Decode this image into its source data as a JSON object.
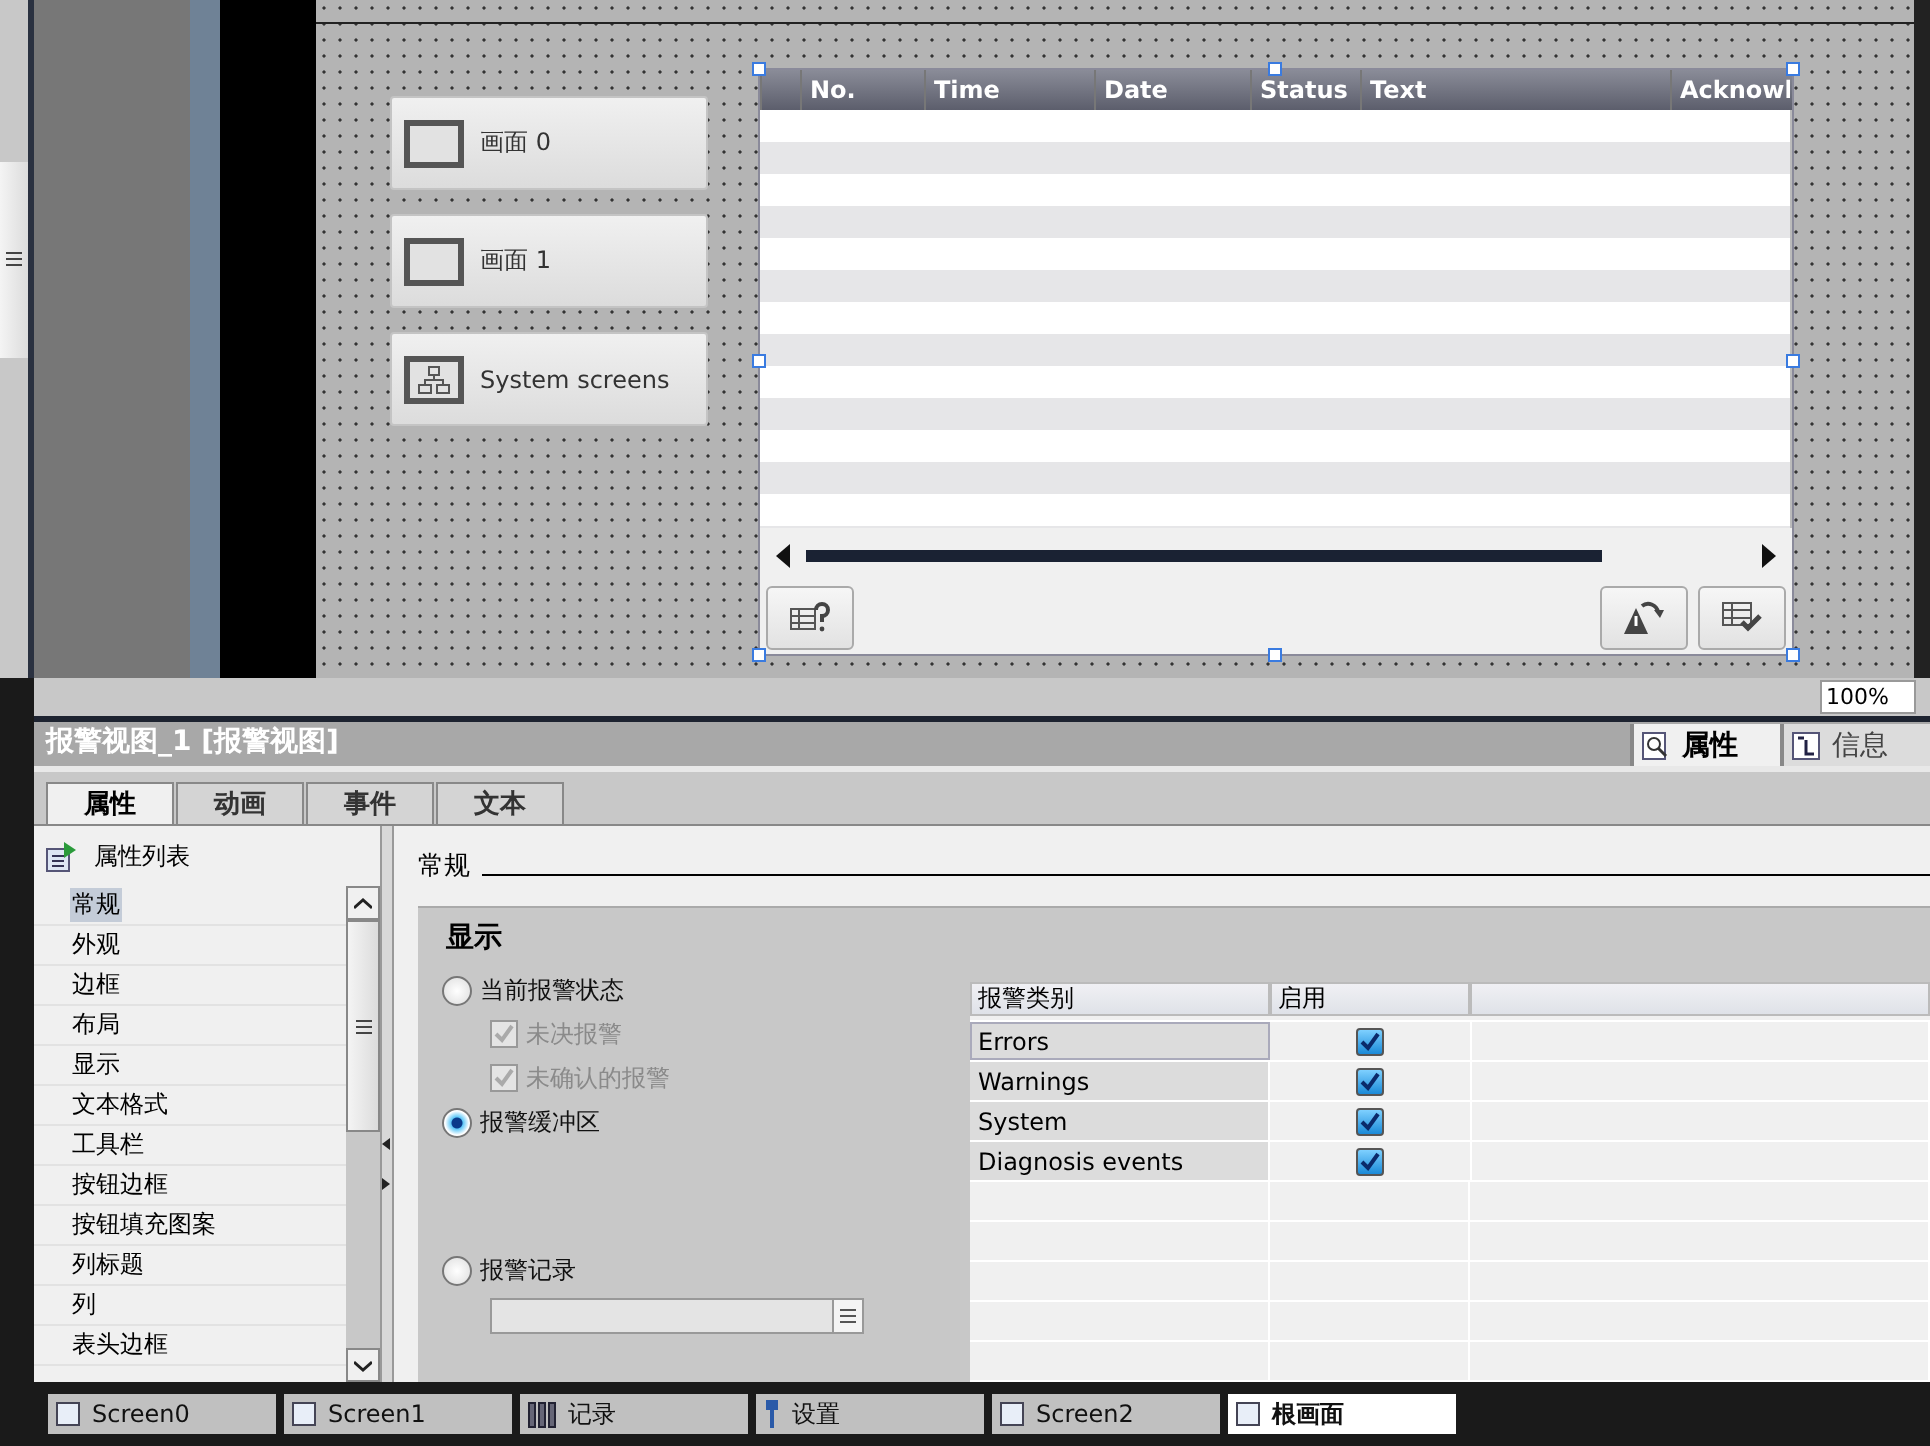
{
  "canvas": {
    "screen_buttons": [
      {
        "label": "画面 0",
        "kind": "screen"
      },
      {
        "label": "画面 1",
        "kind": "screen"
      },
      {
        "label": "System screens",
        "kind": "system"
      }
    ],
    "alarm_view": {
      "columns": [
        "No.",
        "Time",
        "Date",
        "Status",
        "Text",
        "Acknowl"
      ]
    },
    "zoom": "100%"
  },
  "inspector": {
    "title": "报警视图_1 [报警视图]",
    "view_tabs": [
      {
        "label": "属性",
        "kind": "properties",
        "selected": true
      },
      {
        "label": "信息",
        "kind": "info",
        "selected": false
      }
    ],
    "tabs": [
      {
        "label": "属性",
        "selected": true
      },
      {
        "label": "动画",
        "selected": false
      },
      {
        "label": "事件",
        "selected": false
      },
      {
        "label": "文本",
        "selected": false
      }
    ],
    "property_list": {
      "title": "属性列表",
      "items": [
        {
          "label": "常规",
          "selected": true
        },
        {
          "label": "外观",
          "selected": false
        },
        {
          "label": "边框",
          "selected": false
        },
        {
          "label": "布局",
          "selected": false
        },
        {
          "label": "显示",
          "selected": false
        },
        {
          "label": "文本格式",
          "selected": false
        },
        {
          "label": "工具栏",
          "selected": false
        },
        {
          "label": "按钮边框",
          "selected": false
        },
        {
          "label": "按钮填充图案",
          "selected": false
        },
        {
          "label": "列标题",
          "selected": false
        },
        {
          "label": "列",
          "selected": false
        },
        {
          "label": "表头边框",
          "selected": false
        }
      ]
    },
    "section": "常规",
    "group": "显示",
    "options": [
      {
        "kind": "radio",
        "label": "当前报警状态",
        "selected": false
      },
      {
        "kind": "checkbox",
        "label": "未决报警",
        "checked": true,
        "disabled": true
      },
      {
        "kind": "checkbox",
        "label": "未确认的报警",
        "checked": true,
        "disabled": true
      },
      {
        "kind": "radio",
        "label": "报警缓冲区",
        "selected": true
      },
      {
        "kind": "radio",
        "label": "报警记录",
        "selected": false
      }
    ],
    "class_table": {
      "columns": [
        "报警类别",
        "启用"
      ],
      "rows": [
        {
          "name": "Errors",
          "enabled": true,
          "selected": true
        },
        {
          "name": "Warnings",
          "enabled": true,
          "selected": false
        },
        {
          "name": "System",
          "enabled": true,
          "selected": false
        },
        {
          "name": "Diagnosis events",
          "enabled": true,
          "selected": false
        }
      ]
    }
  },
  "taskbar": [
    {
      "label": "Screen0",
      "kind": "screen",
      "selected": false
    },
    {
      "label": "Screen1",
      "kind": "screen",
      "selected": false
    },
    {
      "label": "记录",
      "kind": "records",
      "selected": false
    },
    {
      "label": "设置",
      "kind": "settings",
      "selected": false
    },
    {
      "label": "Screen2",
      "kind": "screen",
      "selected": false
    },
    {
      "label": "根画面",
      "kind": "screen",
      "selected": true
    }
  ]
}
